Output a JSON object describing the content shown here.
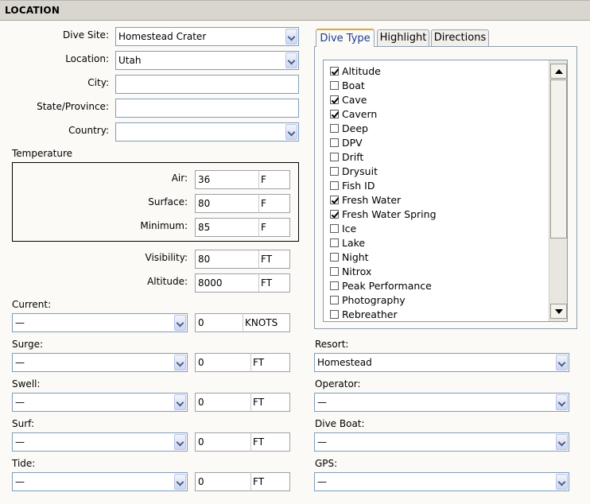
{
  "header": {
    "title": "LOCATION"
  },
  "left": {
    "dive_site": {
      "label": "Dive Site:",
      "value": "Homestead Crater"
    },
    "location": {
      "label": "Location:",
      "value": "Utah"
    },
    "city": {
      "label": "City:",
      "value": ""
    },
    "state": {
      "label": "State/Province:",
      "value": ""
    },
    "country": {
      "label": "Country:",
      "value": ""
    },
    "temperature": {
      "label": "Temperature",
      "air": {
        "label": "Air:",
        "value": "36",
        "unit": "F"
      },
      "surface": {
        "label": "Surface:",
        "value": "80",
        "unit": "F"
      },
      "minimum": {
        "label": "Minimum:",
        "value": "85",
        "unit": "F"
      }
    },
    "visibility": {
      "label": "Visibility:",
      "value": "80",
      "unit": "FT"
    },
    "altitude": {
      "label": "Altitude:",
      "value": "8000",
      "unit": "FT"
    },
    "current": {
      "label": "Current:",
      "select": "—",
      "value": "0",
      "unit": "KNOTS"
    },
    "surge": {
      "label": "Surge:",
      "select": "—",
      "value": "0",
      "unit": "FT"
    },
    "swell": {
      "label": "Swell:",
      "select": "—",
      "value": "0",
      "unit": "FT"
    },
    "surf": {
      "label": "Surf:",
      "select": "—",
      "value": "0",
      "unit": "FT"
    },
    "tide": {
      "label": "Tide:",
      "select": "—",
      "value": "0",
      "unit": "FT"
    }
  },
  "tabs": [
    {
      "label": "Dive Type",
      "active": true
    },
    {
      "label": "Highlight",
      "active": false
    },
    {
      "label": "Directions",
      "active": false
    }
  ],
  "dive_types": [
    {
      "label": "Altitude",
      "checked": true
    },
    {
      "label": "Boat",
      "checked": false
    },
    {
      "label": "Cave",
      "checked": true
    },
    {
      "label": "Cavern",
      "checked": true
    },
    {
      "label": "Deep",
      "checked": false
    },
    {
      "label": "DPV",
      "checked": false
    },
    {
      "label": "Drift",
      "checked": false
    },
    {
      "label": "Drysuit",
      "checked": false
    },
    {
      "label": "Fish ID",
      "checked": false
    },
    {
      "label": "Fresh Water",
      "checked": true
    },
    {
      "label": "Fresh Water Spring",
      "checked": true
    },
    {
      "label": "Ice",
      "checked": false
    },
    {
      "label": "Lake",
      "checked": false
    },
    {
      "label": "Night",
      "checked": false
    },
    {
      "label": "Nitrox",
      "checked": false
    },
    {
      "label": "Peak Performance",
      "checked": false
    },
    {
      "label": "Photography",
      "checked": false
    },
    {
      "label": "Rebreather",
      "checked": false
    }
  ],
  "right": {
    "resort": {
      "label": "Resort:",
      "value": "Homestead"
    },
    "operator": {
      "label": "Operator:",
      "value": "—"
    },
    "dive_boat": {
      "label": "Dive Boat:",
      "value": "—"
    },
    "gps": {
      "label": "GPS:",
      "value": "—"
    }
  }
}
